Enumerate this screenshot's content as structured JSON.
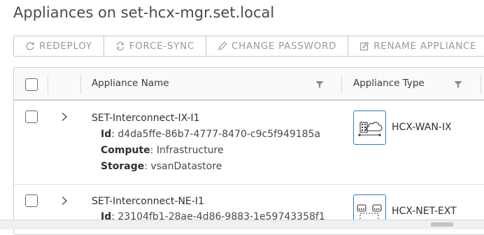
{
  "page": {
    "title": "Appliances on set-hcx-mgr.set.local"
  },
  "toolbar": {
    "redeploy": "REDEPLOY",
    "force_sync": "FORCE-SYNC",
    "change_password": "CHANGE PASSWORD",
    "rename_appliance": "RENAME APPLIANCE"
  },
  "table": {
    "columns": {
      "name": "Appliance Name",
      "type": "Appliance Type"
    },
    "rows": [
      {
        "name": "SET-Interconnect-IX-I1",
        "id_label": "Id",
        "id_value": ": d4da5ffe-86b7-4777-8470-c9c5f949185a",
        "compute_label": "Compute",
        "compute_value": ": Infrastructure",
        "storage_label": "Storage",
        "storage_value": ": vsanDatastore",
        "type": "HCX-WAN-IX",
        "type_icon": "wan-ix-cloud-icon"
      },
      {
        "name": "SET-Interconnect-NE-I1",
        "id_label": "Id",
        "id_value": ": 23104fb1-28ae-4d86-9883-1e59743358f1",
        "type": "HCX-NET-EXT",
        "type_icon": "net-ext-switch-icon"
      }
    ]
  },
  "colors": {
    "accent": "#2f7bbd",
    "toolbar_text": "#9a9a9a"
  }
}
